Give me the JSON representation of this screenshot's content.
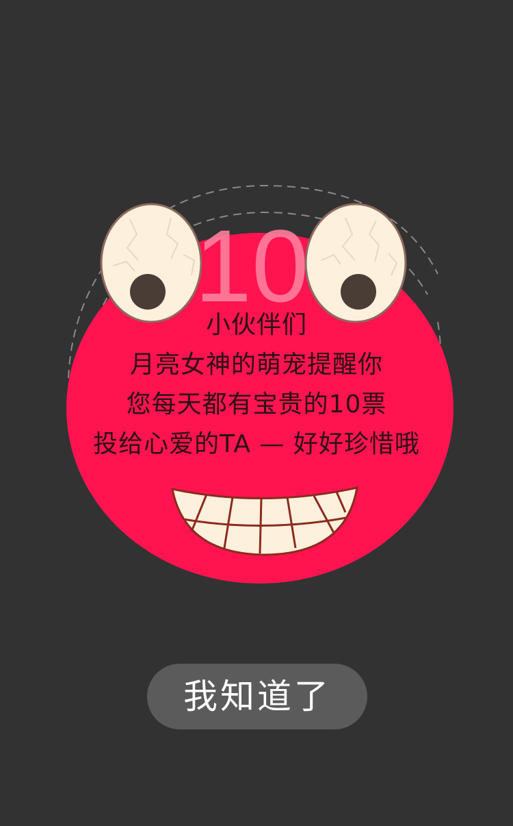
{
  "mascot": {
    "counter_text": "10",
    "face_color": "#ff1450",
    "eye_color": "#fdf0dc",
    "pupil_color": "#4a3d35"
  },
  "message": {
    "lines": [
      "小伙伴们",
      "月亮女神的萌宠提醒你",
      "您每天都有宝贵的10票",
      "投给心爱的TA — 好好珍惜哦"
    ]
  },
  "dismiss_button": {
    "label": "我知道了"
  },
  "theme": {
    "background": "#323232",
    "button_bg": "#5b5b5b"
  }
}
